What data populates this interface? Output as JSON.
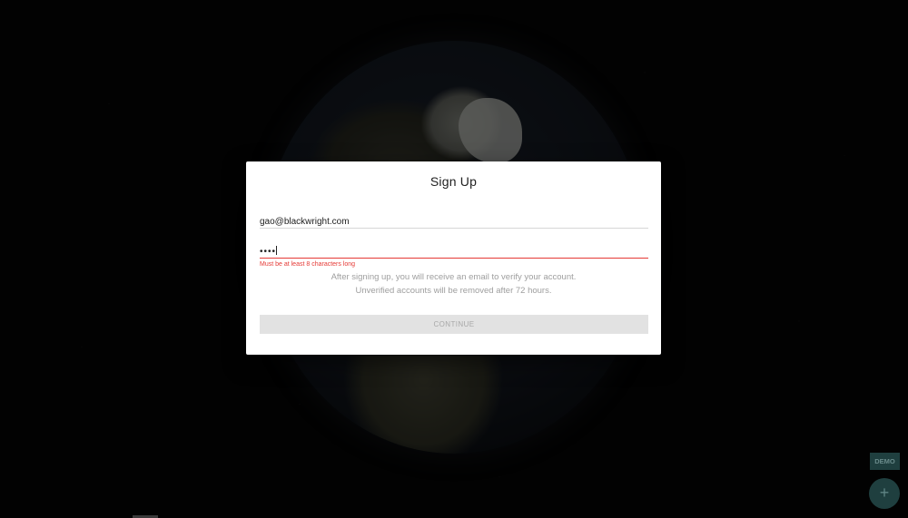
{
  "dialog": {
    "title": "Sign Up",
    "email_value": "gao@blackwright.com",
    "password_value": "••••",
    "password_error": "Must be at least 8 characters long",
    "info_line_1": "After signing up, you will receive an email to verify your account.",
    "info_line_2": "Unverified accounts will be removed after 72 hours.",
    "continue_label": "CONTINUE"
  },
  "corner": {
    "demo_label": "DEMO",
    "fab_icon": "plus-icon",
    "fab_glyph": "+"
  },
  "colors": {
    "error": "#e53935",
    "accent_dark": "#1f3f3f",
    "button_disabled": "#e2e2e2"
  }
}
